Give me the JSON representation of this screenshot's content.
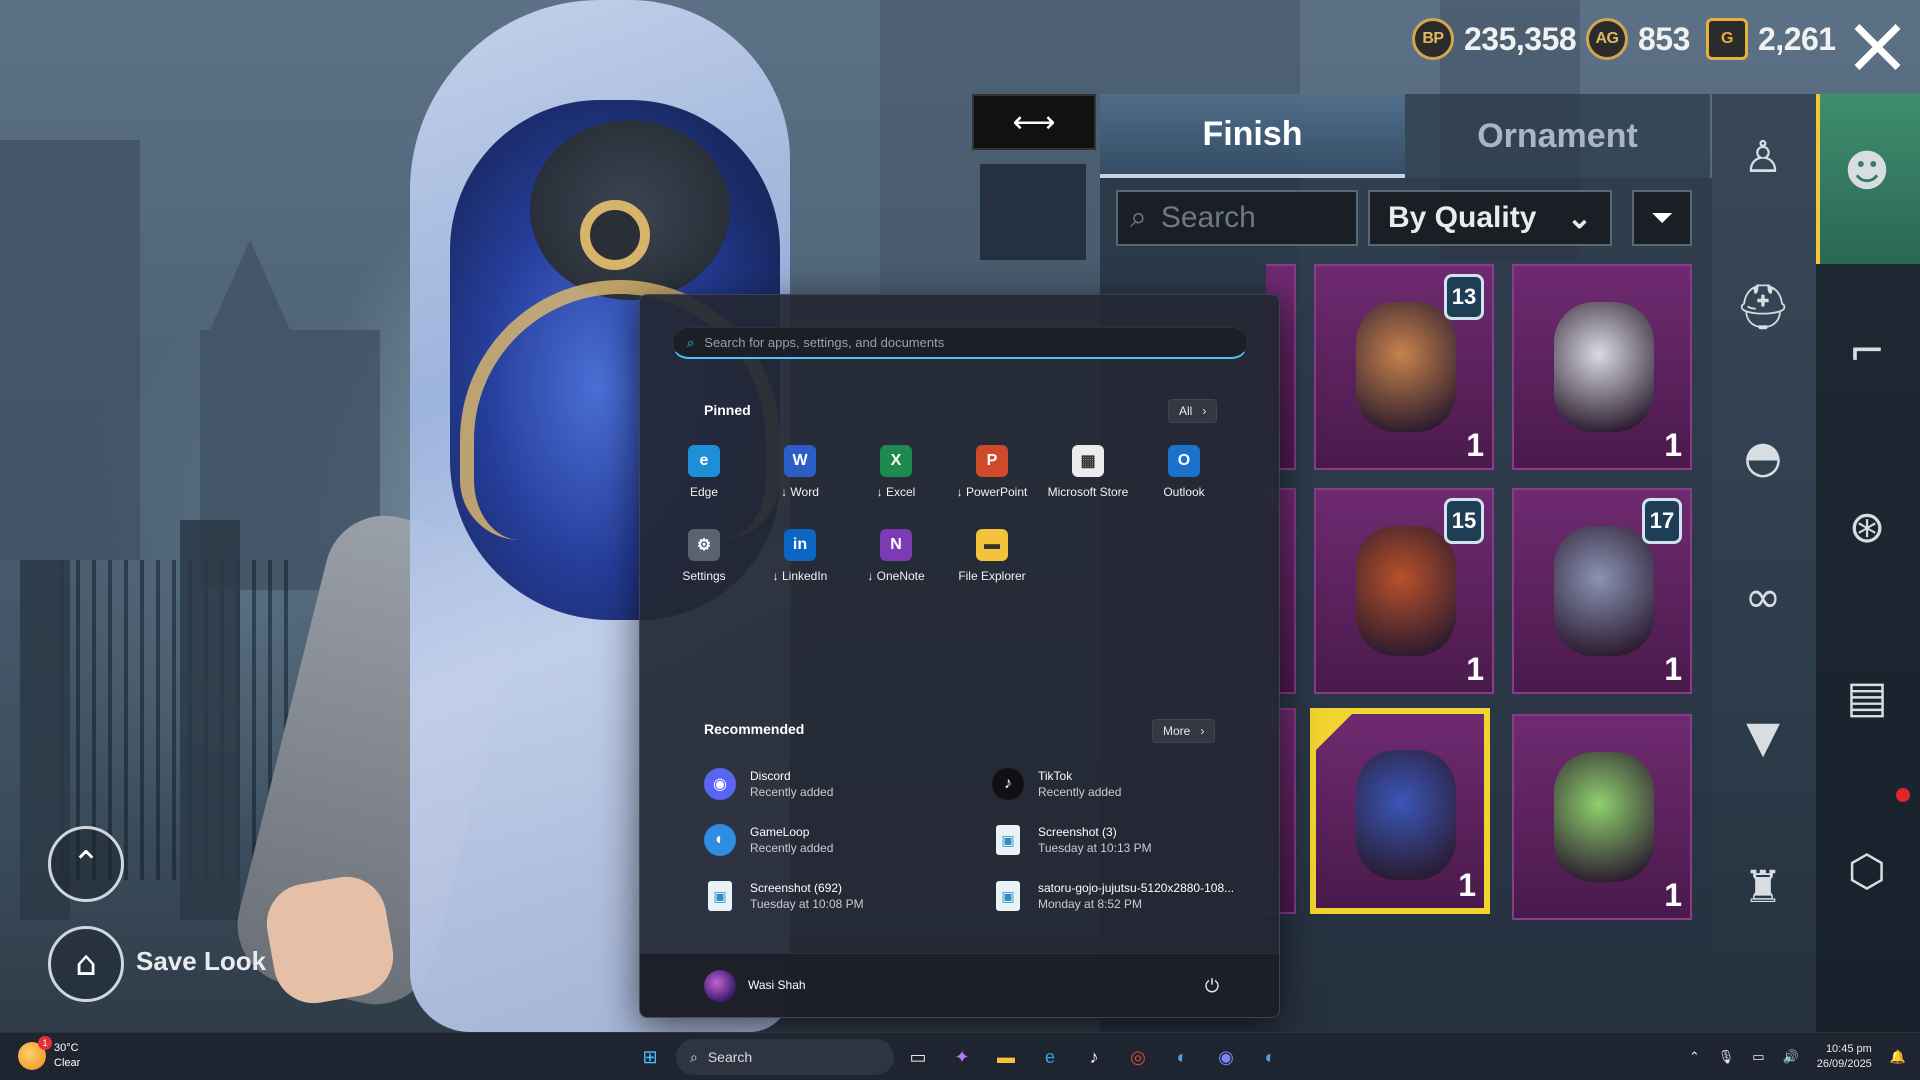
{
  "game": {
    "currencies": [
      {
        "icon": "bp-coin-icon",
        "symbol": "BP",
        "value": "235,358"
      },
      {
        "icon": "ag-coin-icon",
        "symbol": "AG",
        "value": "853"
      },
      {
        "icon": "g-coin-icon",
        "symbol": "G",
        "value": "2,261"
      }
    ],
    "tabs": [
      {
        "label": "Finish",
        "active": true
      },
      {
        "label": "Ornament",
        "active": false
      }
    ],
    "search_placeholder": "Search",
    "sort_value": "By Quality",
    "items": [
      {
        "level": "13",
        "qty": "1",
        "color": "#c7834c",
        "selected": false
      },
      {
        "level": "",
        "qty": "1",
        "color": "#d9dce2",
        "selected": false
      },
      {
        "level": "15",
        "qty": "1",
        "color": "#b8512a",
        "selected": false
      },
      {
        "level": "17",
        "qty": "1",
        "color": "#8a93b4",
        "selected": false
      },
      {
        "level": "",
        "qty": "1",
        "color": "#3a57b8",
        "selected": true
      },
      {
        "level": "",
        "qty": "1",
        "color": "#8fd16e",
        "selected": false
      }
    ],
    "save_look_label": "Save Look"
  },
  "start_menu": {
    "search_placeholder": "Search for apps, settings, and documents",
    "pinned_title": "Pinned",
    "all_button": "All",
    "pinned": [
      {
        "label": "Edge",
        "icon": "edge-icon",
        "glyph": "e",
        "color": "#1c8fd6"
      },
      {
        "label": "↓ Word",
        "icon": "word-icon",
        "glyph": "W",
        "color": "#2b5fc7"
      },
      {
        "label": "↓ Excel",
        "icon": "excel-icon",
        "glyph": "X",
        "color": "#1d8a4f"
      },
      {
        "label": "↓ PowerPoint",
        "icon": "powerpoint-icon",
        "glyph": "P",
        "color": "#d0492a"
      },
      {
        "label": "Microsoft Store",
        "icon": "store-icon",
        "glyph": "▦",
        "color": "#ececec"
      },
      {
        "label": "Outlook",
        "icon": "outlook-icon",
        "glyph": "O",
        "color": "#1a73c9"
      },
      {
        "label": "Settings",
        "icon": "settings-icon",
        "glyph": "⚙",
        "color": "#5a6270"
      },
      {
        "label": "↓ LinkedIn",
        "icon": "linkedin-icon",
        "glyph": "in",
        "color": "#0a66c2"
      },
      {
        "label": "↓ OneNote",
        "icon": "onenote-icon",
        "glyph": "N",
        "color": "#7a3bb5"
      },
      {
        "label": "File Explorer",
        "icon": "folder-icon",
        "glyph": "▬",
        "color": "#f2c33c"
      }
    ],
    "recommended_title": "Recommended",
    "more_button": "More",
    "recommended": [
      {
        "name": "Discord",
        "sub": "Recently added",
        "icon": "discord-icon",
        "type": "app",
        "color": "#5865f2",
        "glyph": "◉"
      },
      {
        "name": "TikTok",
        "sub": "Recently added",
        "icon": "tiktok-icon",
        "type": "app",
        "color": "#111111",
        "glyph": "♪"
      },
      {
        "name": "GameLoop",
        "sub": "Recently added",
        "icon": "gameloop-icon",
        "type": "app",
        "color": "#2e8de0",
        "glyph": "◐"
      },
      {
        "name": "Screenshot (3)",
        "sub": "Tuesday at 10:13 PM",
        "icon": "image-file-icon",
        "type": "file",
        "color": "#e9f2f7",
        "glyph": "▣"
      },
      {
        "name": "Screenshot (692)",
        "sub": "Tuesday at 10:08 PM",
        "icon": "image-file-icon",
        "type": "file",
        "color": "#e9f2f7",
        "glyph": "▣"
      },
      {
        "name": "satoru-gojo-jujutsu-5120x2880-108...",
        "sub": "Monday at 8:52 PM",
        "icon": "image-file-icon",
        "type": "file",
        "color": "#e9f2f7",
        "glyph": "▣"
      }
    ],
    "user_name": "Wasi Shah"
  },
  "taskbar": {
    "weather_temp": "30°C",
    "weather_desc": "Clear",
    "weather_badge": "1",
    "search_label": "Search",
    "apps": [
      {
        "icon": "windows-start-icon",
        "glyph": "⊞",
        "color": "#4cc2ff"
      },
      {
        "icon": "task-view-icon",
        "glyph": "▭",
        "color": "#e6e6e6"
      },
      {
        "icon": "copilot-icon",
        "glyph": "✦",
        "color": "#b07cf0"
      },
      {
        "icon": "file-explorer-icon",
        "glyph": "▬",
        "color": "#f2c33c"
      },
      {
        "icon": "edge-icon",
        "glyph": "e",
        "color": "#2da7e0"
      },
      {
        "icon": "tiktok-icon",
        "glyph": "♪",
        "color": "#ffffff"
      },
      {
        "icon": "chrome-icon",
        "glyph": "◎",
        "color": "#e8453c"
      },
      {
        "icon": "gameloop-icon",
        "glyph": "◐",
        "color": "#4aa3f0"
      },
      {
        "icon": "discord-icon",
        "glyph": "◉",
        "color": "#7b86f5"
      },
      {
        "icon": "gameloop-icon",
        "glyph": "◐",
        "color": "#4aa3f0"
      }
    ],
    "time": "10:45 pm",
    "date": "26/09/2025"
  }
}
